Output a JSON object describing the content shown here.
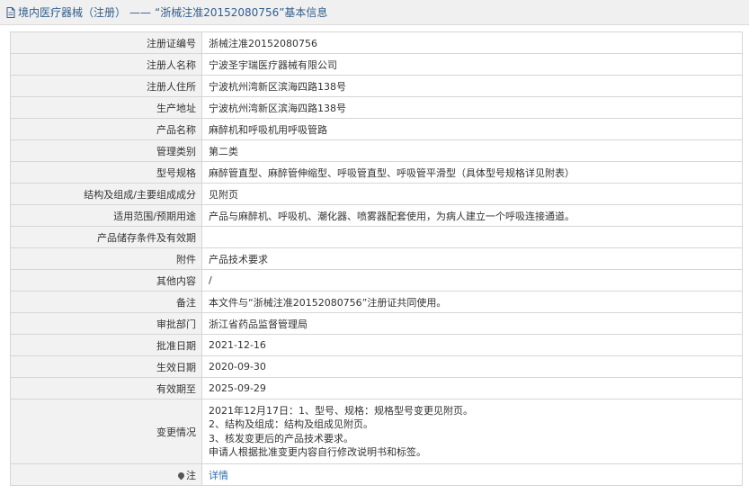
{
  "header": {
    "crumb": "境内医疗器械（注册）",
    "separator": "——",
    "title": "“浙械注准20152080756”基本信息",
    "icon": "document-icon"
  },
  "rows": [
    {
      "label": "注册证编号",
      "value": "浙械注准20152080756"
    },
    {
      "label": "注册人名称",
      "value": "宁波圣宇瑞医疗器械有限公司"
    },
    {
      "label": "注册人住所",
      "value": "宁波杭州湾新区滨海四路138号"
    },
    {
      "label": "生产地址",
      "value": "宁波杭州湾新区滨海四路138号"
    },
    {
      "label": "产品名称",
      "value": "麻醉机和呼吸机用呼吸管路"
    },
    {
      "label": "管理类别",
      "value": "第二类"
    },
    {
      "label": "型号规格",
      "value": "麻醉管直型、麻醉管伸缩型、呼吸管直型、呼吸管平滑型（具体型号规格详见附表）"
    },
    {
      "label": "结构及组成/主要组成成分",
      "value": "见附页"
    },
    {
      "label": "适用范围/预期用途",
      "value": "产品与麻醉机、呼吸机、潮化器、喷雾器配套使用，为病人建立一个呼吸连接通道。"
    },
    {
      "label": "产品储存条件及有效期",
      "value": ""
    },
    {
      "label": "附件",
      "value": "产品技术要求"
    },
    {
      "label": "其他内容",
      "value": "/"
    },
    {
      "label": "备注",
      "value": "本文件与“浙械注准20152080756”注册证共同使用。"
    },
    {
      "label": "审批部门",
      "value": "浙江省药品监督管理局"
    },
    {
      "label": "批准日期",
      "value": "2021-12-16"
    },
    {
      "label": "生效日期",
      "value": "2020-09-30"
    },
    {
      "label": "有效期至",
      "value": "2025-09-29"
    }
  ],
  "change": {
    "label": "变更情况",
    "lines": [
      "2021年12月17日：1、型号、规格：规格型号变更见附页。",
      "2、结构及组成：结构及组成见附页。",
      "3、核发变更后的产品技术要求。",
      "申请人根据批准变更内容自行修改说明书和标签。"
    ]
  },
  "note": {
    "label": "注",
    "icon": "map-pin-icon",
    "link": "详情"
  }
}
